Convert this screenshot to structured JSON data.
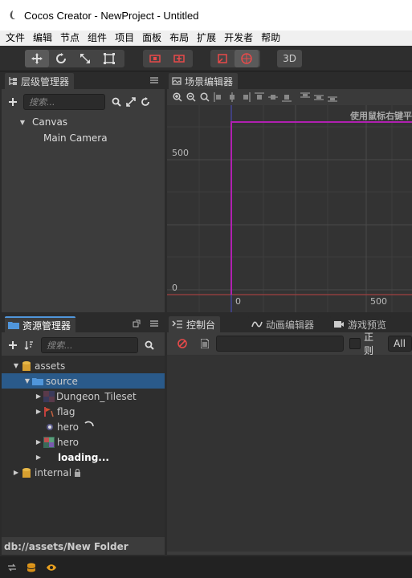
{
  "window": {
    "title": "Cocos Creator - NewProject - Untitled"
  },
  "menubar": {
    "items": [
      "文件",
      "编辑",
      "节点",
      "组件",
      "项目",
      "面板",
      "布局",
      "扩展",
      "开发者",
      "帮助"
    ]
  },
  "toolbar": {
    "mode_3d_label": "3D"
  },
  "hierarchy": {
    "tab_label": "层级管理器",
    "search_placeholder": "搜索...",
    "nodes": [
      {
        "label": "Canvas"
      },
      {
        "label": "Main Camera"
      }
    ]
  },
  "scene": {
    "tab_label": "场景编辑器",
    "hint_text": "使用鼠标右键平",
    "axis": {
      "y_500": "500",
      "y_0": "0",
      "x_0": "0",
      "x_500": "500"
    }
  },
  "assets": {
    "tab_label": "资源管理器",
    "search_placeholder": "搜索...",
    "items": [
      {
        "label": "assets"
      },
      {
        "label": "source"
      },
      {
        "label": "Dungeon_Tileset"
      },
      {
        "label": "flag"
      },
      {
        "label": "hero"
      },
      {
        "label": "hero"
      },
      {
        "label": "internal"
      }
    ],
    "loading_text": "loading...",
    "footer_path": "db://assets/New Folder"
  },
  "console": {
    "tabs": [
      "控制台",
      "动画编辑器",
      "游戏预览"
    ],
    "regex_label": "正则",
    "level_select": "All"
  },
  "colors": {
    "accent_blue": "#5096db",
    "selection": "#2a5a8a",
    "design_frame": "#b020b0",
    "folder_orange": "#d8a030"
  }
}
